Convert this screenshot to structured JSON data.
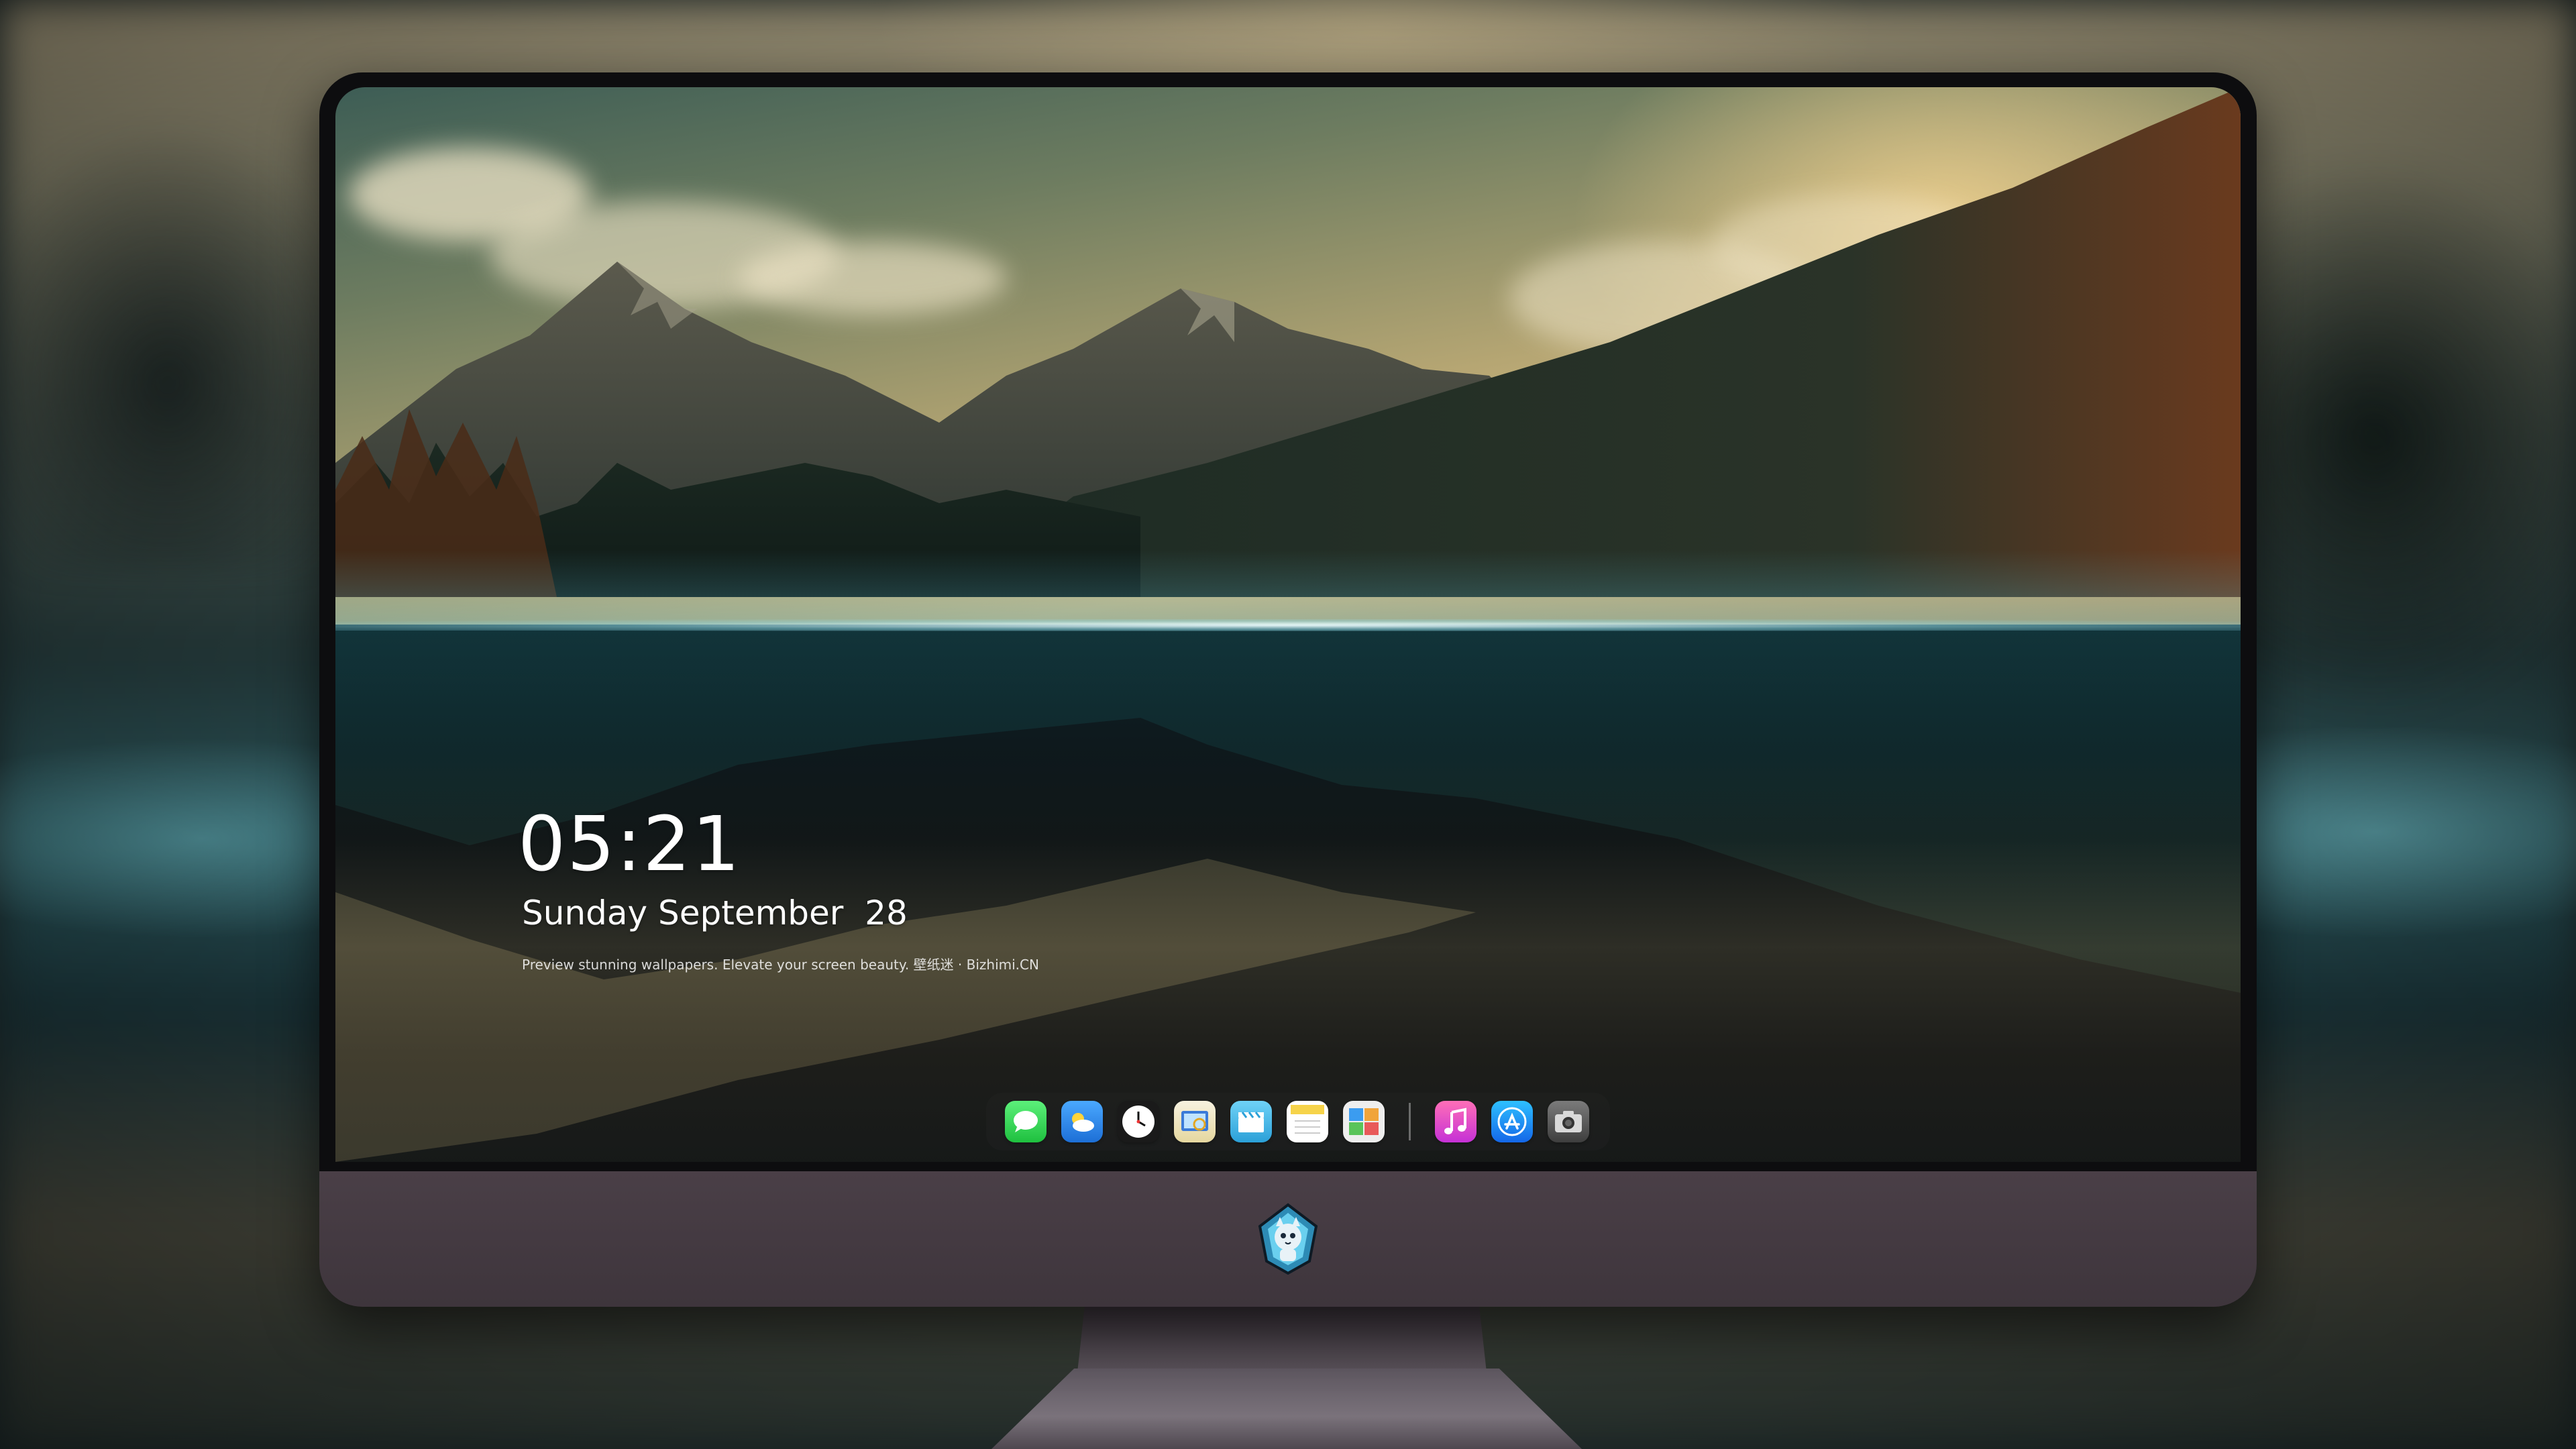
{
  "lock_screen": {
    "time": "05:21",
    "date": "Sunday September  28",
    "tagline": "Preview stunning wallpapers. Elevate your screen beauty. 壁纸迷 · Bizhimi.CN"
  },
  "dock": {
    "apps": [
      {
        "name": "messages",
        "icon": "chat-bubble-icon",
        "color": "#2fd14b"
      },
      {
        "name": "weather",
        "icon": "cloud-icon",
        "color": "#2f86e8"
      },
      {
        "name": "clock",
        "icon": "clock-icon",
        "color": "#111111"
      },
      {
        "name": "preview",
        "icon": "photo-viewer-icon",
        "color": "#e8c240"
      },
      {
        "name": "clips",
        "icon": "clapperboard-icon",
        "color": "#3fb5e6"
      },
      {
        "name": "notes",
        "icon": "notes-icon",
        "color": "#f6d34a"
      },
      {
        "name": "photo-booth",
        "icon": "gallery-icon",
        "color": "#ececec"
      },
      {
        "name": "music",
        "icon": "music-note-icon",
        "color": "#e0479e"
      },
      {
        "name": "app-store",
        "icon": "app-store-icon",
        "color": "#1a8cf5"
      },
      {
        "name": "camera",
        "icon": "camera-icon",
        "color": "#5a5a5a"
      }
    ]
  },
  "colors": {
    "chin": "#4a3f47",
    "bezel": "#0d0d0f",
    "water_glow": "#9ad9e2"
  }
}
